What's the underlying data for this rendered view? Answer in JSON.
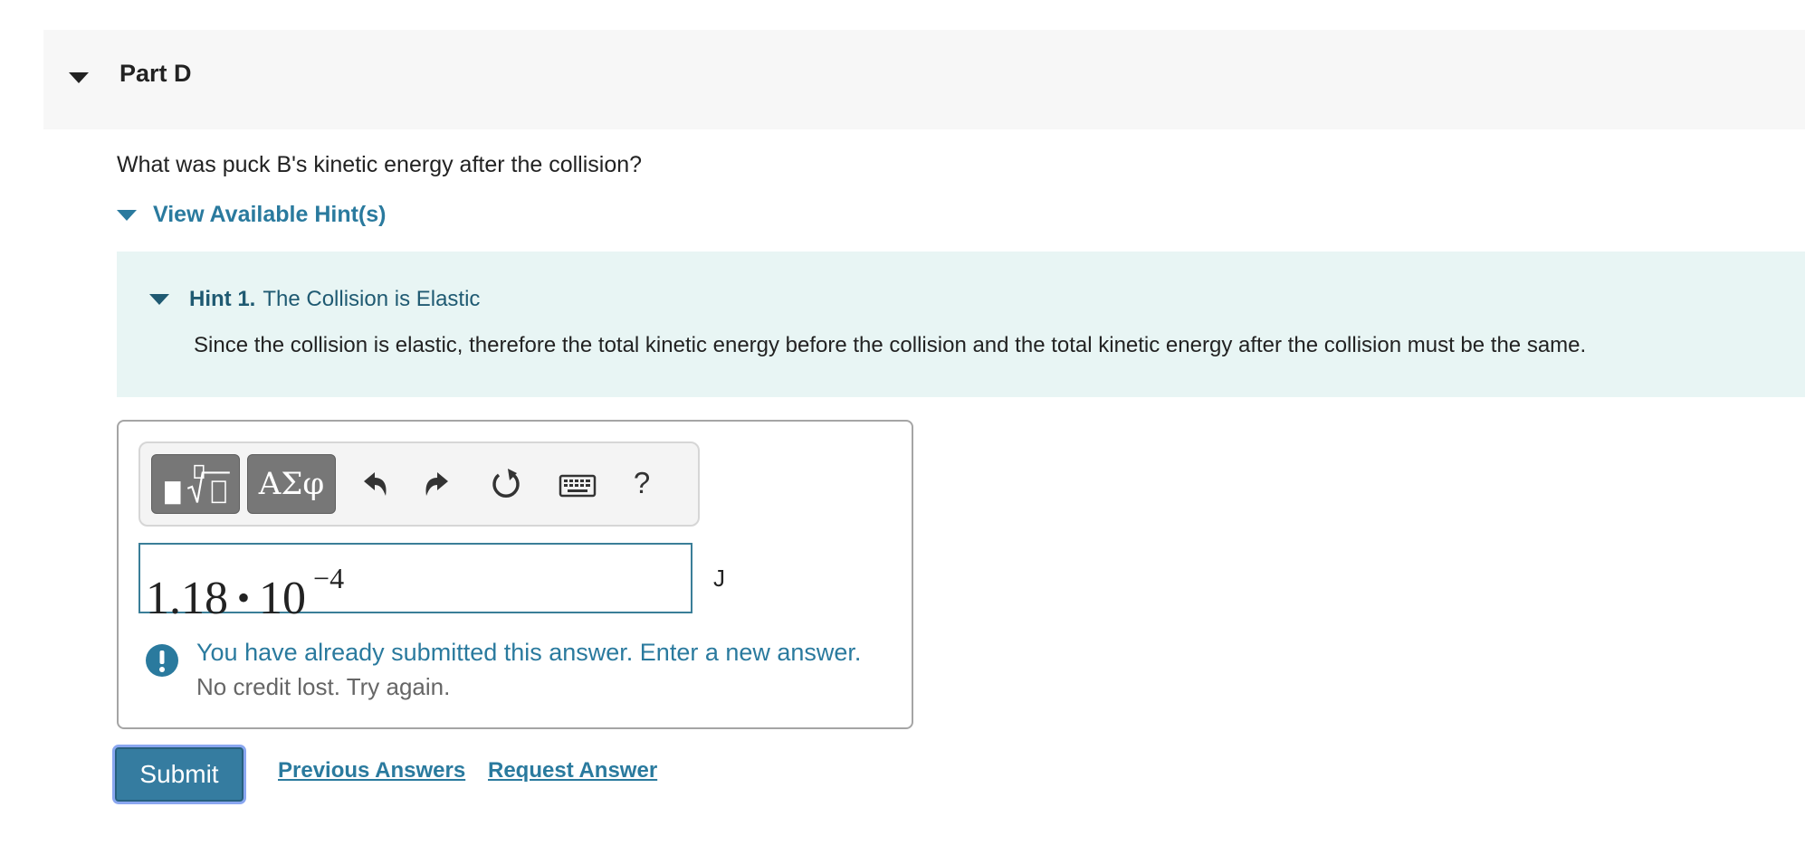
{
  "part": {
    "title": "Part D"
  },
  "question": {
    "text": "What was puck B's kinetic energy after the collision?"
  },
  "hints": {
    "toggle_label": "View Available Hint(s)",
    "items": [
      {
        "number": "Hint 1.",
        "title": "The Collision is Elastic",
        "body": "Since the collision is elastic, therefore the total kinetic energy before the collision and the total kinetic energy after the collision must be the same."
      }
    ]
  },
  "toolbar": {
    "templates_icon": "fraction-sqrt-templates-icon",
    "greek_label": "ΑΣφ",
    "undo_icon": "undo-icon",
    "redo_icon": "redo-icon",
    "reset_icon": "reset-icon",
    "keyboard_icon": "keyboard-icon",
    "help_label": "?"
  },
  "answer": {
    "mantissa": "1.18",
    "operator": "•",
    "base": "10",
    "exponent": "−4",
    "unit": "J"
  },
  "feedback": {
    "icon": "exclamation-icon",
    "message": "You have already submitted this answer. Enter a new answer.",
    "sub_message": "No credit lost. Try again."
  },
  "actions": {
    "submit_label": "Submit",
    "previous_answers_label": "Previous Answers",
    "request_answer_label": "Request Answer"
  },
  "colors": {
    "accent": "#2a7a9e",
    "hint_background": "#e8f5f4",
    "submit_background": "#357ca0",
    "header_background": "#f7f7f7"
  }
}
